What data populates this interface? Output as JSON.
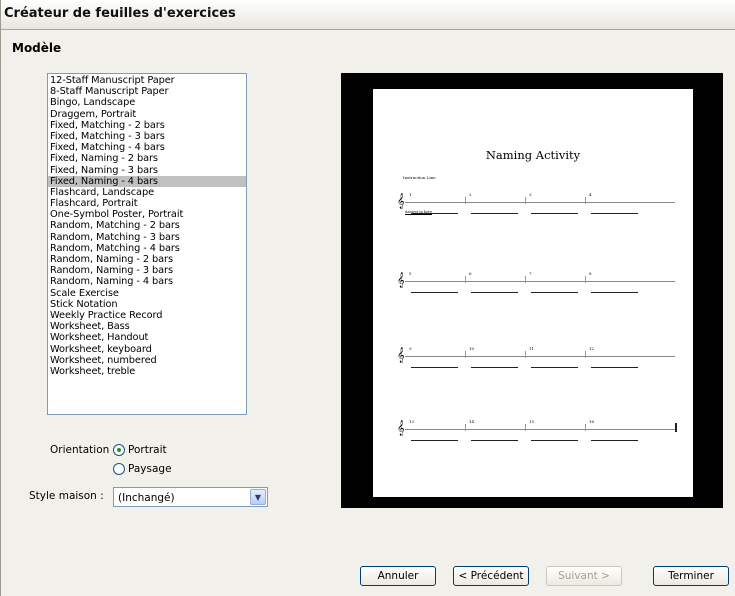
{
  "window": {
    "title": "Créateur de feuilles d'exercices"
  },
  "section": {
    "label": "Modèle"
  },
  "templates": [
    "12-Staff Manuscript Paper",
    "8-Staff Manuscript Paper",
    "Bingo, Landscape",
    "Draggem, Portrait",
    "Fixed, Matching - 2 bars",
    "Fixed, Matching - 3 bars",
    "Fixed, Matching - 4 bars",
    "Fixed, Naming - 2 bars",
    "Fixed, Naming - 3 bars",
    "Fixed, Naming - 4 bars",
    "Flashcard, Landscape",
    "Flashcard, Portrait",
    "One-Symbol Poster, Portrait",
    "Random, Matching - 2 bars",
    "Random, Matching - 3 bars",
    "Random, Matching - 4 bars",
    "Random, Naming - 2 bars",
    "Random, Naming - 3 bars",
    "Random, Naming - 4 bars",
    "Scale Exercise",
    "Stick Notation",
    "Weekly Practice Record",
    "Worksheet, Bass",
    "Worksheet, Handout",
    "Worksheet, keyboard",
    "Worksheet, numbered",
    "Worksheet, treble"
  ],
  "selected_template": "Fixed, Naming - 4 bars",
  "orientation": {
    "label": "Orientation :",
    "portrait": "Portrait",
    "landscape": "Paysage",
    "selected": "Portrait"
  },
  "house_style": {
    "label": "Style maison :",
    "value": "(Inchangé)"
  },
  "preview": {
    "title": "Naming Activity",
    "instruction": "Instruction Line",
    "answer_hint": "Answer in here",
    "rows": [
      [
        "1",
        "2",
        "3",
        "4"
      ],
      [
        "5",
        "6",
        "7",
        "8"
      ],
      [
        "9",
        "10",
        "11",
        "12"
      ],
      [
        "13",
        "14",
        "15",
        "16"
      ]
    ]
  },
  "buttons": {
    "cancel": "Annuler",
    "previous": "< Précédent",
    "next": "Suivant >",
    "finish": "Terminer"
  },
  "colors": {
    "selection": "#c0c0c0",
    "list_border": "#7f9db9",
    "button_border": "#003c74"
  }
}
